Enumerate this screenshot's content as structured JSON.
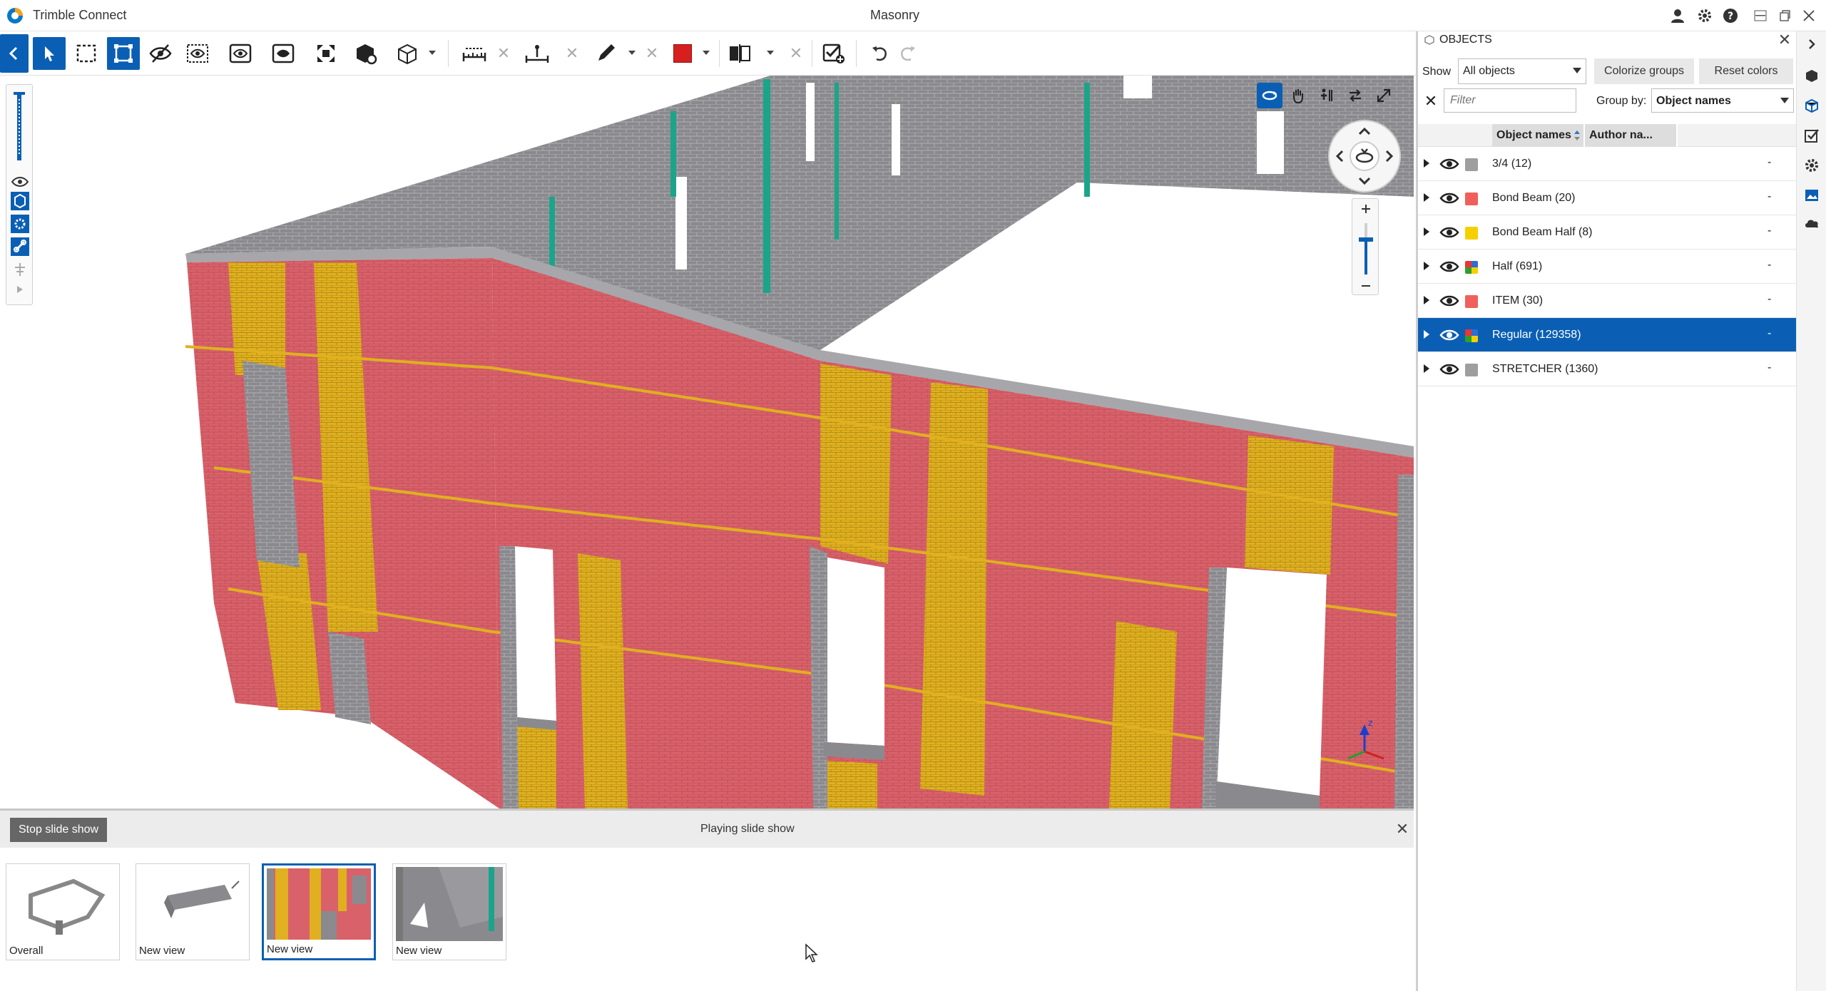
{
  "titlebar": {
    "app_name": "Trimble Connect",
    "document_title": "Masonry"
  },
  "toolbar": {
    "tools": [
      "back-icon",
      "select-icon",
      "box-select-icon",
      "fit-select-icon",
      "hide-icon",
      "isolate-icon",
      "show-all-icon",
      "section-icon",
      "fit-icon",
      "objects-3d-icon",
      "cube-icon",
      "measure-icon",
      "measure-point-icon",
      "markup-pen-icon",
      "color-swatch",
      "compare-icon",
      "clash-icon",
      "undo-icon",
      "redo-icon"
    ],
    "markup_color": "#d62020"
  },
  "viewport": {
    "description_colors": {
      "brick_red": "#d9616a",
      "brick_yellow": "#e0b020",
      "block_gray": "#8a8a8e",
      "teal_accent": "#1aa58a"
    }
  },
  "slideshow": {
    "stop_button": "Stop slide show",
    "status": "Playing slide show",
    "slides": [
      {
        "label": "Overall"
      },
      {
        "label": "New view"
      },
      {
        "label": "New view"
      },
      {
        "label": "New view"
      }
    ],
    "active_index": 2
  },
  "objects_panel": {
    "title": "OBJECTS",
    "show_label": "Show",
    "show_value": "All objects",
    "colorize_button": "Colorize groups",
    "reset_button": "Reset colors",
    "filter_placeholder": "Filter",
    "groupby_label": "Group by:",
    "groupby_value": "Object names",
    "columns": [
      "Object names",
      "Author na..."
    ],
    "rows": [
      {
        "name": "3/4 (12)",
        "color": "#9e9e9e",
        "value": "-"
      },
      {
        "name": "Bond Beam (20)",
        "color": "#f0605a",
        "value": "-"
      },
      {
        "name": "Bond Beam Half (8)",
        "color": "#f5d000",
        "value": "-"
      },
      {
        "name": "Half (691)",
        "color": "multi",
        "value": "-"
      },
      {
        "name": "ITEM (30)",
        "color": "#f0605a",
        "value": "-"
      },
      {
        "name": "Regular (129358)",
        "color": "multi",
        "value": "-"
      },
      {
        "name": "STRETCHER (1360)",
        "color": "#9e9e9e",
        "value": "-"
      }
    ],
    "selected_index": 5
  },
  "accent_color": "#0a5fb4"
}
